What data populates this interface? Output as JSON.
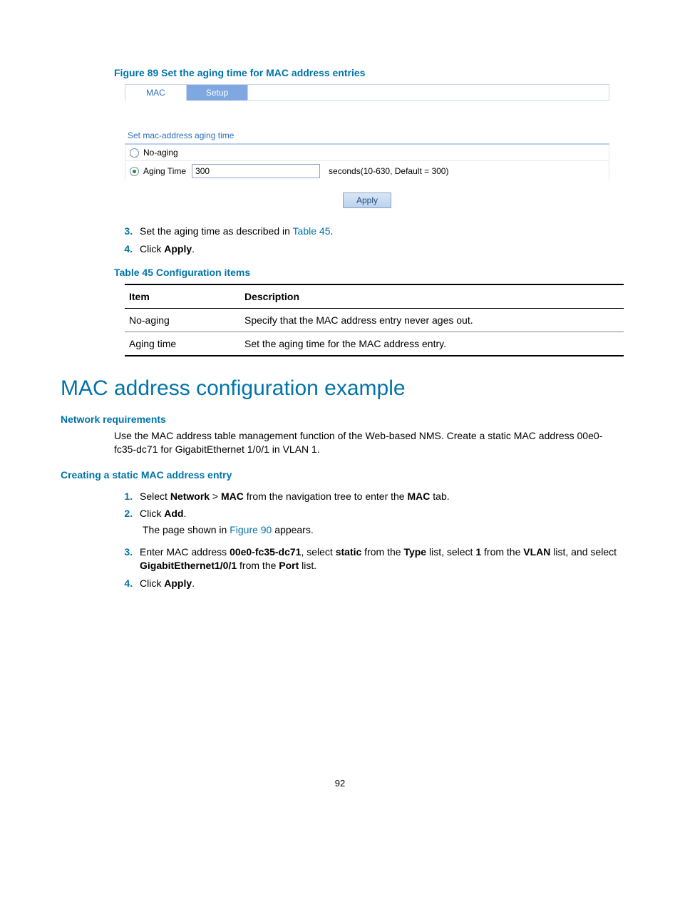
{
  "figure": {
    "caption": "Figure 89 Set the aging time for MAC address entries",
    "tabs": {
      "mac": "MAC",
      "setup": "Setup"
    },
    "section_title": "Set mac-address aging time",
    "noaging_label": "No-aging",
    "agingtime_label": "Aging Time",
    "agingtime_value": "300",
    "agingtime_hint": "seconds(10-630, Default = 300)",
    "apply": "Apply"
  },
  "steps_a": {
    "s3a": "Set the aging time as described in ",
    "s3_link": "Table 45",
    "s3b": ".",
    "s4a": "Click ",
    "s4_bold": "Apply",
    "s4b": "."
  },
  "table45": {
    "caption": "Table 45 Configuration items",
    "head_item": "Item",
    "head_desc": "Description",
    "rows": [
      {
        "item": "No-aging",
        "desc": "Specify that the MAC address entry never ages out."
      },
      {
        "item": "Aging time",
        "desc": "Set the aging time for the MAC address entry."
      }
    ]
  },
  "h1": "MAC address configuration example",
  "sec_netreq": {
    "heading": "Network requirements",
    "para": "Use the MAC address table management function of the Web-based NMS. Create a static MAC address 00e0-fc35-dc71 for GigabitEthernet 1/0/1 in VLAN 1."
  },
  "sec_create": {
    "heading": "Creating a static MAC address entry",
    "s1": {
      "a": "Select ",
      "b1": "Network",
      "gt": " > ",
      "b2": "MAC",
      "c": " from the navigation tree to enter the ",
      "b3": "MAC",
      "d": " tab."
    },
    "s2": {
      "a": "Click ",
      "b": "Add",
      "c": "."
    },
    "s2_sub_a": "The page shown in ",
    "s2_sub_link": "Figure 90",
    "s2_sub_b": " appears.",
    "s3": {
      "a": "Enter MAC address ",
      "b1": "00e0-fc35-dc71",
      "c": ", select ",
      "b2": "static",
      "d": " from the ",
      "b3": "Type",
      "e": " list, select ",
      "b4": "1",
      "f": " from the ",
      "b5": "VLAN",
      "g": " list, and select ",
      "b6": "GigabitEthernet1/0/1",
      "h": " from the ",
      "b7": "Port",
      "i": " list."
    },
    "s4": {
      "a": "Click ",
      "b": "Apply",
      "c": "."
    }
  },
  "page_number": "92"
}
